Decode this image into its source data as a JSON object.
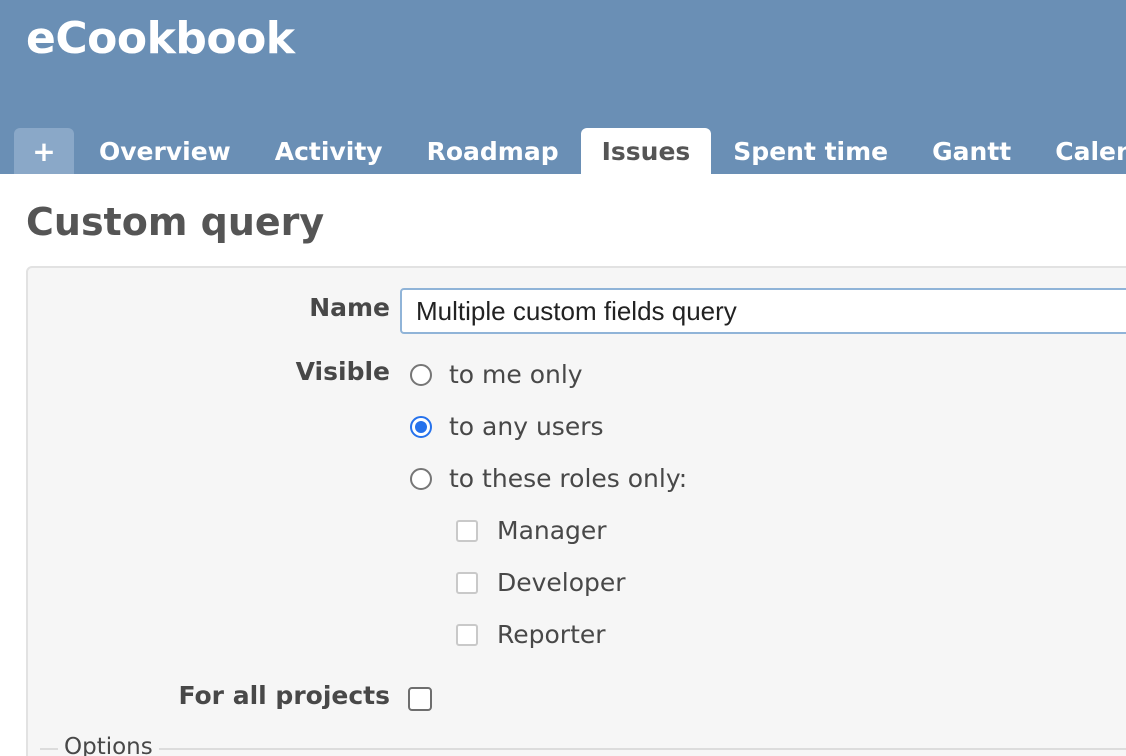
{
  "header": {
    "app_title": "eCookbook",
    "new_tab_label": "+",
    "tabs": [
      {
        "label": "Overview"
      },
      {
        "label": "Activity"
      },
      {
        "label": "Roadmap"
      },
      {
        "label": "Issues"
      },
      {
        "label": "Spent time"
      },
      {
        "label": "Gantt"
      },
      {
        "label": "Calenda"
      }
    ],
    "selected_tab": "Issues"
  },
  "page": {
    "title": "Custom query"
  },
  "form": {
    "name_label": "Name",
    "name_value": "Multiple custom fields query",
    "visible_label": "Visible",
    "visible_options": [
      {
        "label": "to me only",
        "checked": false
      },
      {
        "label": "to any users",
        "checked": true
      },
      {
        "label": "to these roles only:",
        "checked": false
      }
    ],
    "roles": [
      {
        "label": "Manager",
        "checked": false
      },
      {
        "label": "Developer",
        "checked": false
      },
      {
        "label": "Reporter",
        "checked": false
      }
    ],
    "all_projects_label": "For all projects",
    "all_projects_checked": false,
    "options_legend": "Options"
  },
  "colors": {
    "header_bg": "#6a8fb5",
    "radio_accent": "#2672ec",
    "input_border": "#90b4d8"
  }
}
